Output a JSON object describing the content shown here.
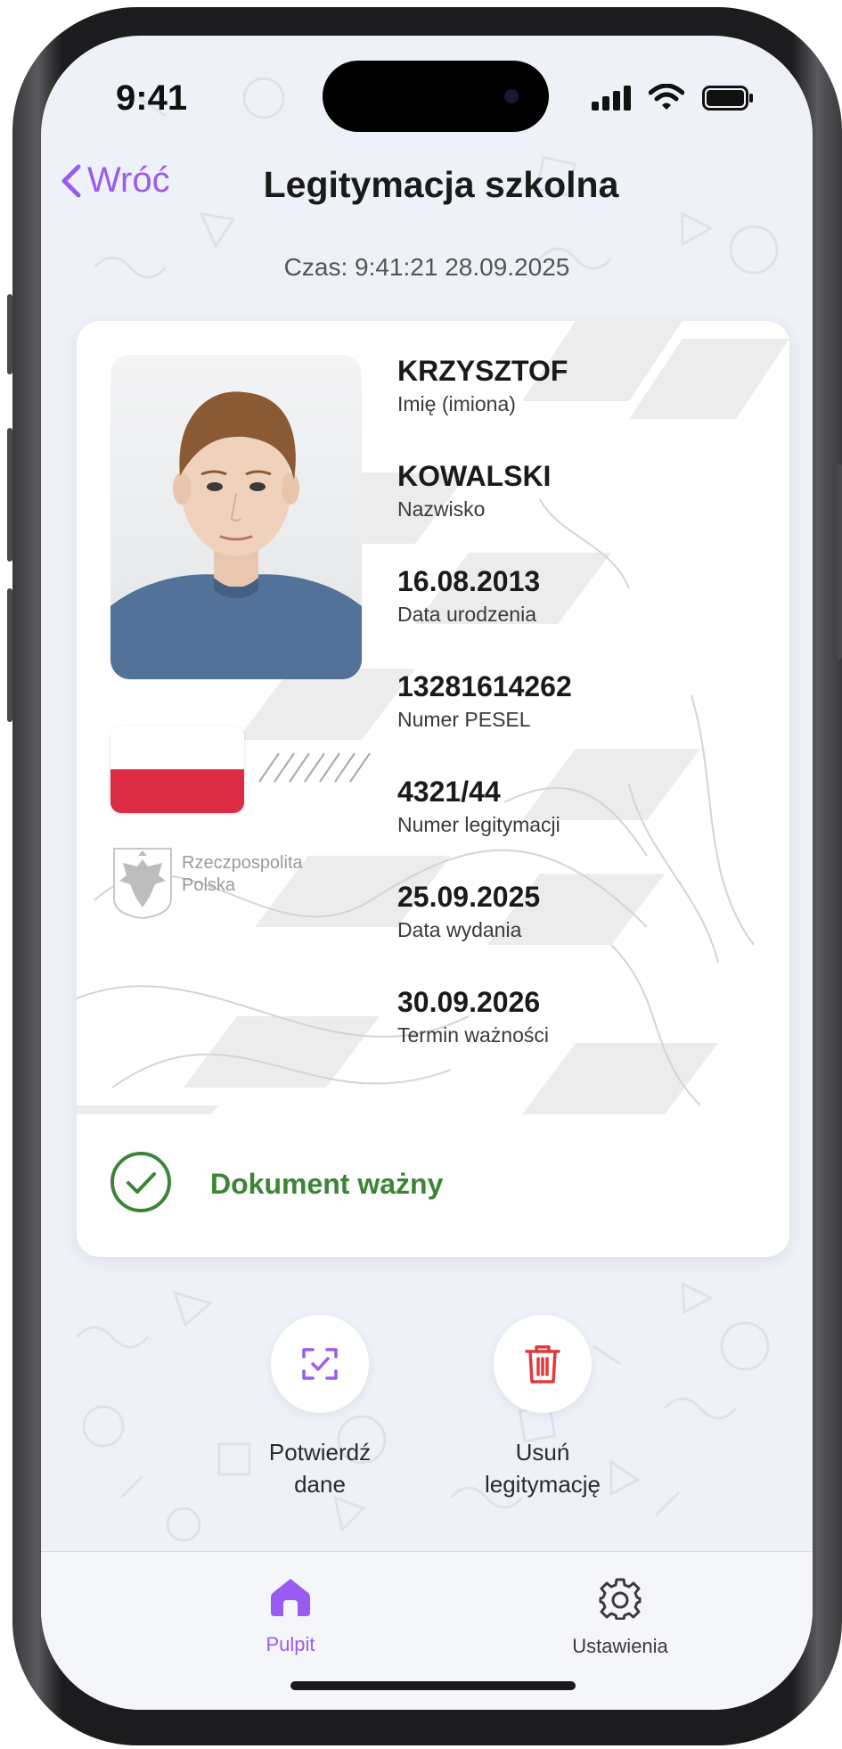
{
  "status_bar": {
    "time": "9:41"
  },
  "nav": {
    "back_label": "Wróć",
    "title": "Legitymacja szkolna"
  },
  "timestamp": "Czas: 9:41:21 28.09.2025",
  "card": {
    "emblem_text_line1": "Rzeczpospolita",
    "emblem_text_line2": "Polska",
    "fields": [
      {
        "value": "KRZYSZTOF",
        "label": "Imię (imiona)"
      },
      {
        "value": "KOWALSKI",
        "label": "Nazwisko"
      },
      {
        "value": "16.08.2013",
        "label": "Data urodzenia"
      },
      {
        "value": "13281614262",
        "label": "Numer PESEL"
      },
      {
        "value": "4321/44",
        "label": "Numer legitymacji"
      },
      {
        "value": "25.09.2025",
        "label": "Data wydania"
      },
      {
        "value": "30.09.2026",
        "label": "Termin ważności"
      }
    ],
    "status_text": "Dokument ważny"
  },
  "actions": {
    "confirm_line1": "Potwierdź",
    "confirm_line2": "dane",
    "delete_line1": "Usuń",
    "delete_line2": "legitymację"
  },
  "tabbar": {
    "home_label": "Pulpit",
    "settings_label": "Ustawienia"
  },
  "colors": {
    "accent": "#9a5cf0",
    "valid_green": "#3b8534",
    "delete_red": "#e03a3a",
    "flag_red": "#dc2d45",
    "background": "#eef2f8"
  },
  "icons": {
    "back": "chevron-left-icon",
    "confirm": "scan-check-icon",
    "delete": "trash-icon",
    "status": "check-circle-icon",
    "home": "home-icon",
    "settings": "gear-icon"
  }
}
